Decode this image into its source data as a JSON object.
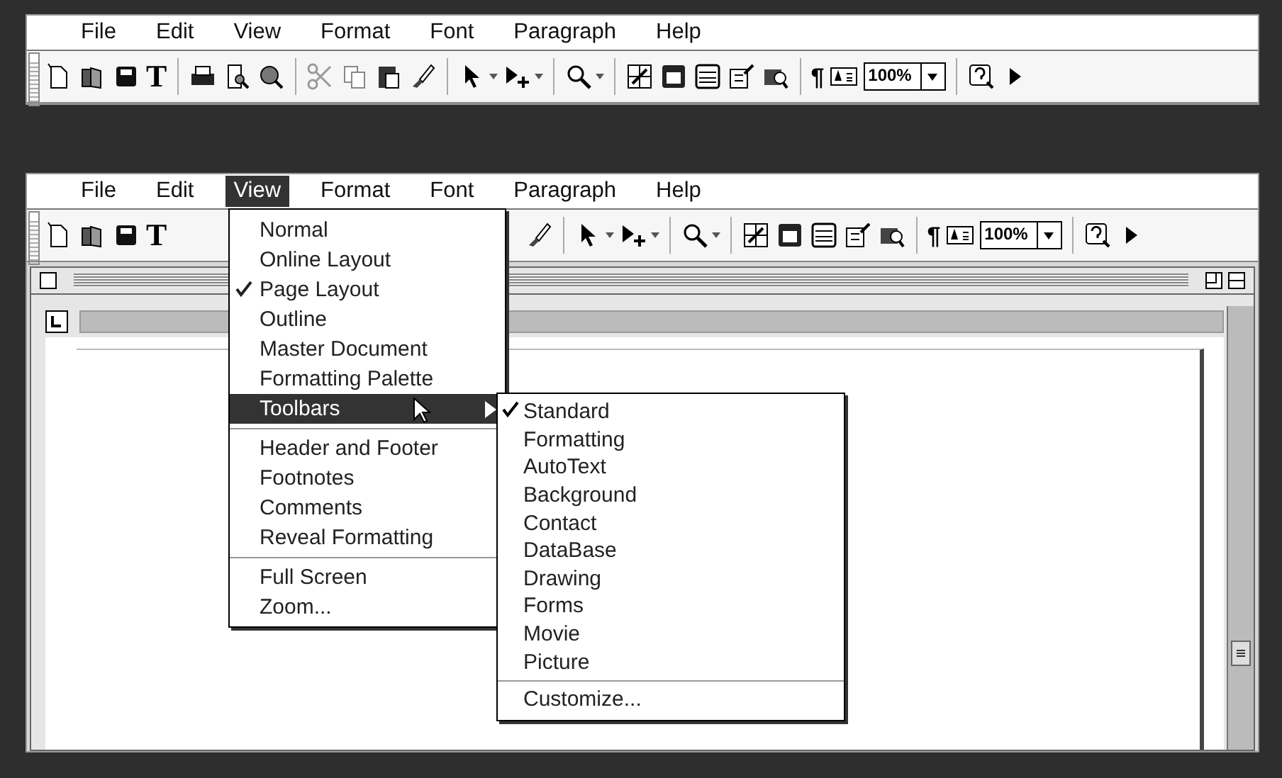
{
  "screens": [
    {
      "menubar": [
        {
          "label": "File",
          "selected": false
        },
        {
          "label": "Edit",
          "selected": false
        },
        {
          "label": "View",
          "selected": false
        },
        {
          "label": "Format",
          "selected": false
        },
        {
          "label": "Font",
          "selected": false
        },
        {
          "label": "Paragraph",
          "selected": false
        },
        {
          "label": "Help",
          "selected": false
        }
      ],
      "toolbar": {
        "glyphs": [
          "T",
          "¶"
        ],
        "zoom": "100%"
      }
    },
    {
      "menubar": [
        {
          "label": "File",
          "selected": false
        },
        {
          "label": "Edit",
          "selected": false
        },
        {
          "label": "View",
          "selected": true
        },
        {
          "label": "Format",
          "selected": false
        },
        {
          "label": "Font",
          "selected": false
        },
        {
          "label": "Paragraph",
          "selected": false
        },
        {
          "label": "Help",
          "selected": false
        }
      ],
      "toolbar": {
        "glyphs": [
          "T",
          "¶"
        ],
        "zoom": "100%"
      },
      "view_menu": {
        "groups": [
          [
            {
              "label": "Normal",
              "checked": false,
              "selected": false
            },
            {
              "label": "Online Layout",
              "checked": false,
              "selected": false
            },
            {
              "label": "Page Layout",
              "checked": true,
              "selected": false
            },
            {
              "label": "Outline",
              "checked": false,
              "selected": false
            },
            {
              "label": "Master Document",
              "checked": false,
              "selected": false
            },
            {
              "label": "Formatting Palette",
              "checked": false,
              "selected": false
            },
            {
              "label": "Toolbars",
              "checked": false,
              "selected": true,
              "submenu": true
            }
          ],
          [
            {
              "label": "Header and Footer",
              "checked": false,
              "selected": false
            },
            {
              "label": "Footnotes",
              "checked": false,
              "selected": false
            },
            {
              "label": "Comments",
              "checked": false,
              "selected": false
            },
            {
              "label": "Reveal Formatting",
              "checked": false,
              "selected": false
            }
          ],
          [
            {
              "label": "Full Screen",
              "checked": false,
              "selected": false
            },
            {
              "label": "Zoom...",
              "checked": false,
              "selected": false
            }
          ]
        ]
      },
      "toolbars_submenu": {
        "groups": [
          [
            {
              "label": "Standard",
              "checked": true
            },
            {
              "label": "Formatting",
              "checked": false
            },
            {
              "label": "AutoText",
              "checked": false
            },
            {
              "label": "Background",
              "checked": false
            },
            {
              "label": "Contact",
              "checked": false
            },
            {
              "label": "DataBase",
              "checked": false
            },
            {
              "label": "Drawing",
              "checked": false
            },
            {
              "label": "Forms",
              "checked": false
            },
            {
              "label": "Movie",
              "checked": false
            },
            {
              "label": "Picture",
              "checked": false
            }
          ],
          [
            {
              "label": "Customize...",
              "checked": false
            }
          ]
        ]
      }
    }
  ]
}
